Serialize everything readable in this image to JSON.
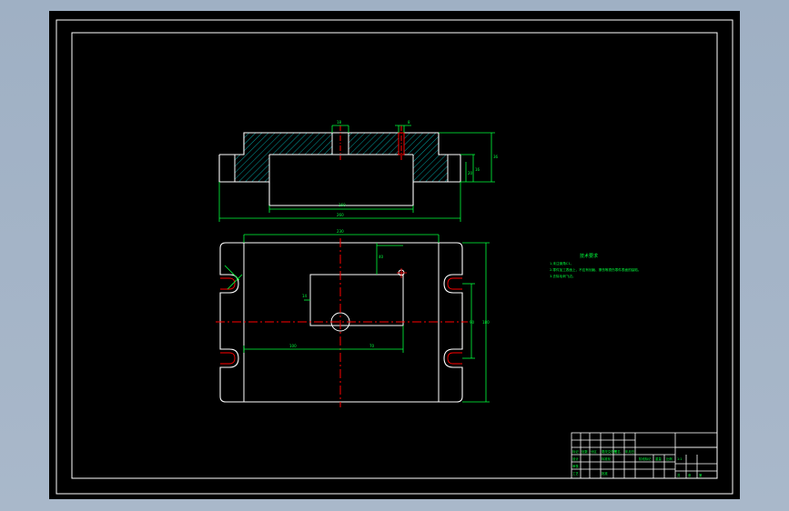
{
  "drawing": {
    "notes_title": "技术要求",
    "notes": [
      "1.未注倒角C1。",
      "2.零件加工表面上，不应有划痕、擦伤等损伤零件表面的缺陷。",
      "3.去除毛刺飞边。"
    ]
  },
  "dimensions": {
    "top_width_small": "18",
    "top_width_right": "8",
    "height_total": "36",
    "height_step": "16",
    "height_inner": "20",
    "inner_width": "160",
    "overall_width": "260",
    "plan_width": "230",
    "plan_height": "180",
    "offset_top": "40",
    "offset_side": "14",
    "plan_half_height": "90",
    "left_offset": "100",
    "right_offset": "70"
  },
  "title_block": {
    "cells": [
      "标记",
      "处数",
      "分区",
      "更改文件号",
      "签名",
      "年月日",
      "设计",
      "标准化",
      "审核",
      "工艺",
      "批准",
      "阶段标记",
      "重量",
      "比例",
      "1:1",
      "共",
      "张",
      "第"
    ]
  },
  "colors": {
    "background": "#000000",
    "outline": "#ffffff",
    "dimension": "#00ff3c",
    "centerline": "#ff0000",
    "hatch": "#00c8c8"
  }
}
